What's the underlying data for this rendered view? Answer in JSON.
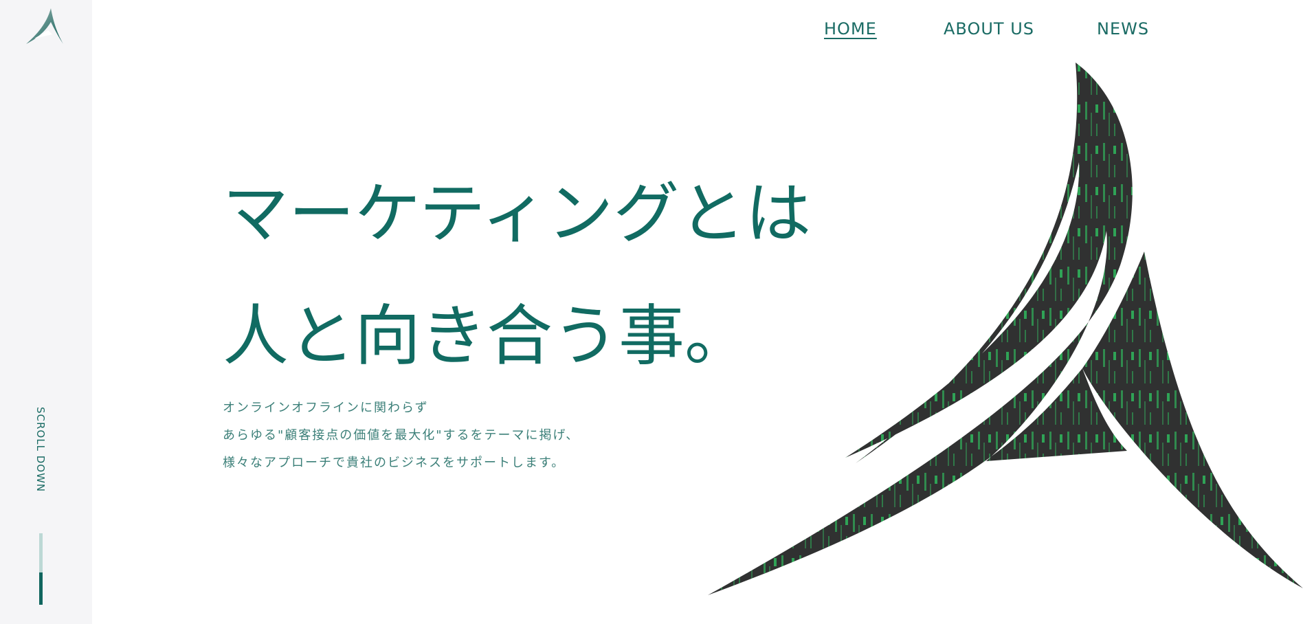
{
  "brand": {
    "logo_icon": "stylized-A-logo-icon",
    "accent_color": "#116b62",
    "dark_color": "#303131",
    "code_green": "#31e36b"
  },
  "nav": {
    "items": [
      {
        "label": "HOME",
        "active": true
      },
      {
        "label": "ABOUT US",
        "active": false
      },
      {
        "label": "NEWS",
        "active": false
      }
    ]
  },
  "sidebar": {
    "scroll_label": "SCROLL DOWN",
    "scroll_progress": 0.45
  },
  "hero": {
    "headline_line1": "マーケティングとは",
    "headline_line2": "人と向き合う事。",
    "body_line1": "オンラインオフラインに関わらず",
    "body_line2": "あらゆる\"顧客接点の価値を最大化\"するをテーマに掲げ、",
    "body_line3": "様々なアプローチで貴社のビジネスをサポートします。",
    "graphic_icon": "matrix-code-A-graphic"
  }
}
